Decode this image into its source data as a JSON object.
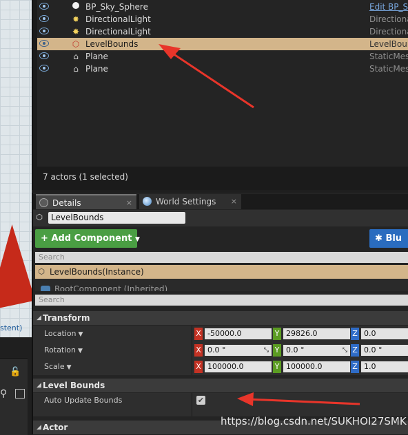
{
  "viewport": {
    "caption": "stent)"
  },
  "outliner": {
    "rows": [
      {
        "name": "BP_Sky_Sphere",
        "type": "Edit BP_Sl",
        "icon": "sphere-icon"
      },
      {
        "name": "DirectionalLight",
        "type": "Directional",
        "icon": "sun-light-icon"
      },
      {
        "name": "DirectionalLight",
        "type": "Directional",
        "icon": "sun-light-icon"
      },
      {
        "name": "LevelBounds",
        "type": "LevelBounc",
        "icon": "level-bounds-icon"
      },
      {
        "name": "Plane",
        "type": "StaticMesh",
        "icon": "static-mesh-icon"
      },
      {
        "name": "Plane",
        "type": "StaticMesh",
        "icon": "static-mesh-icon"
      }
    ],
    "status": "7 actors (1 selected)"
  },
  "details": {
    "tabs": [
      {
        "label": "Details",
        "close": "×"
      },
      {
        "label": "World Settings",
        "close": "×"
      }
    ],
    "actor_name": "LevelBounds",
    "add_component": "Add Component",
    "blueprint_label": "Blu",
    "search_placeholder": "Search",
    "instance_label": "LevelBounds(Instance)",
    "root_component_peek": "RootComponent (Inherited)",
    "search2_placeholder": "Search",
    "transform": {
      "category": "Transform",
      "location": {
        "label": "Location",
        "x": "-50000.0",
        "y": "29826.0",
        "z": "0.0"
      },
      "rotation": {
        "label": "Rotation",
        "x": "0.0 °",
        "y": "0.0 °",
        "z": "0.0 °"
      },
      "scale": {
        "label": "Scale",
        "x": "100000.0",
        "y": "100000.0",
        "z": "1.0"
      }
    },
    "level_bounds": {
      "category": "Level Bounds",
      "auto_update_label": "Auto Update Bounds",
      "auto_update_checked": true
    },
    "actor_category": "Actor",
    "axis_labels": {
      "x": "X",
      "y": "Y",
      "z": "Z"
    }
  },
  "watermark": "https://blog.csdn.net/SUKHOI27SMK",
  "colors": {
    "selection": "#d3b58a",
    "add_component": "#4a9e43",
    "blueprint": "#2a6cbf",
    "arrow": "#e8352a"
  }
}
